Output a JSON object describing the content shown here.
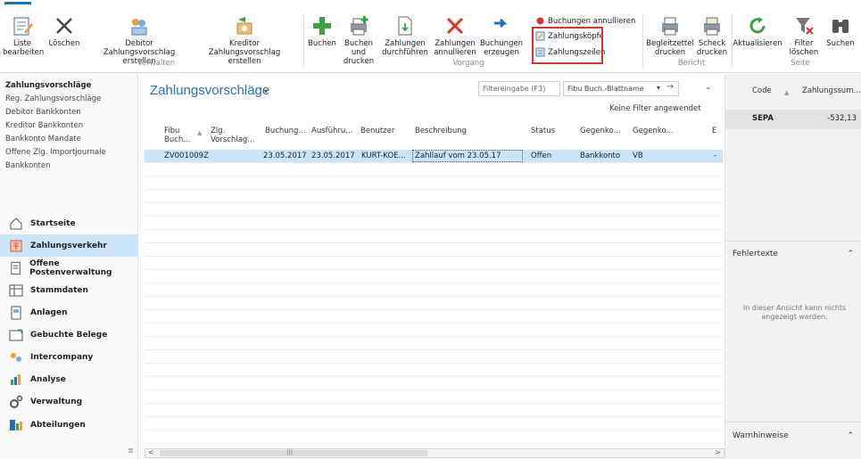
{
  "ribbon": {
    "verwalten": {
      "group_label": "Verwalten",
      "buttons": [
        {
          "line1": "Liste",
          "line2": "bearbeiten"
        },
        {
          "line1": "Löschen",
          "line2": ""
        },
        {
          "line1": "Debitor",
          "line2": "Zahlungsvorschlag erstellen"
        },
        {
          "line1": "Kreditor",
          "line2": "Zahlungsvorschlag erstellen"
        }
      ]
    },
    "vorgang": {
      "group_label": "Vorgang",
      "buttons": [
        {
          "line1": "Buchen",
          "line2": ""
        },
        {
          "line1": "Buchen und",
          "line2": "drucken"
        },
        {
          "line1": "Zahlungen",
          "line2": "durchführen"
        },
        {
          "line1": "Zahlungen",
          "line2": "annullieren"
        },
        {
          "line1": "Buchungen",
          "line2": "erzeugen"
        }
      ],
      "small_buttons": [
        "Buchungen annullieren",
        "Zahlungsköpfe",
        "Zahlungszeilen"
      ]
    },
    "bericht": {
      "group_label": "Bericht",
      "buttons": [
        {
          "line1": "Begleitzettel",
          "line2": "drucken"
        },
        {
          "line1": "Scheck",
          "line2": "drucken"
        }
      ]
    },
    "seite": {
      "group_label": "Seite",
      "buttons": [
        {
          "line1": "Aktualisieren",
          "line2": ""
        },
        {
          "line1": "Filter",
          "line2": "löschen"
        },
        {
          "line1": "Suchen",
          "line2": ""
        }
      ]
    }
  },
  "leftnav": {
    "subitems": [
      "Zahlungsvorschläge",
      "Reg. Zahlungsvorschläge",
      "Debitor Bankkonten",
      "Kreditor Bankkonten",
      "Bankkonto Mandate",
      "Offene Zlg. Importjournale",
      "Bankkonten"
    ],
    "sections": [
      "Startseite",
      "Zahlungsverkehr",
      "Offene Postenverwaltung",
      "Stammdaten",
      "Anlagen",
      "Gebuchte Belege",
      "Intercompany",
      "Analyse",
      "Verwaltung",
      "Abteilungen"
    ]
  },
  "main": {
    "title": "Zahlungsvorschläge",
    "filter_placeholder": "Filtereingabe (F3)",
    "filter_field": "Fibu Buch.-Blattname",
    "no_filter": "Keine Filter angewendet",
    "columns": [
      "Fibu Buch...",
      "Zlg. Vorschlag...",
      "Buchung...",
      "Ausführu...",
      "Benutzer",
      "Beschreibung",
      "Status",
      "Gegenko...",
      "Gegenko...",
      "E"
    ],
    "rows": [
      {
        "fibu": "ZV001009Z",
        "zlg": "",
        "buchung": "23.05.2017",
        "ausfuehrung": "23.05.2017",
        "benutzer": "KURT-KOE...",
        "beschreibung": "Zahllauf vom 23.05.17",
        "status": "Offen",
        "gegenko1": "Bankkonto",
        "gegenko2": "VB",
        "e": "-"
      }
    ]
  },
  "right": {
    "col_code": "Code",
    "col_sum": "Zahlungssum...",
    "row_code": "SEPA",
    "row_sum": "-532,13",
    "fehlertexte": "Fehlertexte",
    "empty_msg": "In dieser Ansicht kann nichts angezeigt werden.",
    "warnhinweise": "Warnhinweise"
  },
  "colors": {
    "accent": "#1f6fbf",
    "selection": "#cce4f7",
    "highlight_box": "#e0312b"
  }
}
